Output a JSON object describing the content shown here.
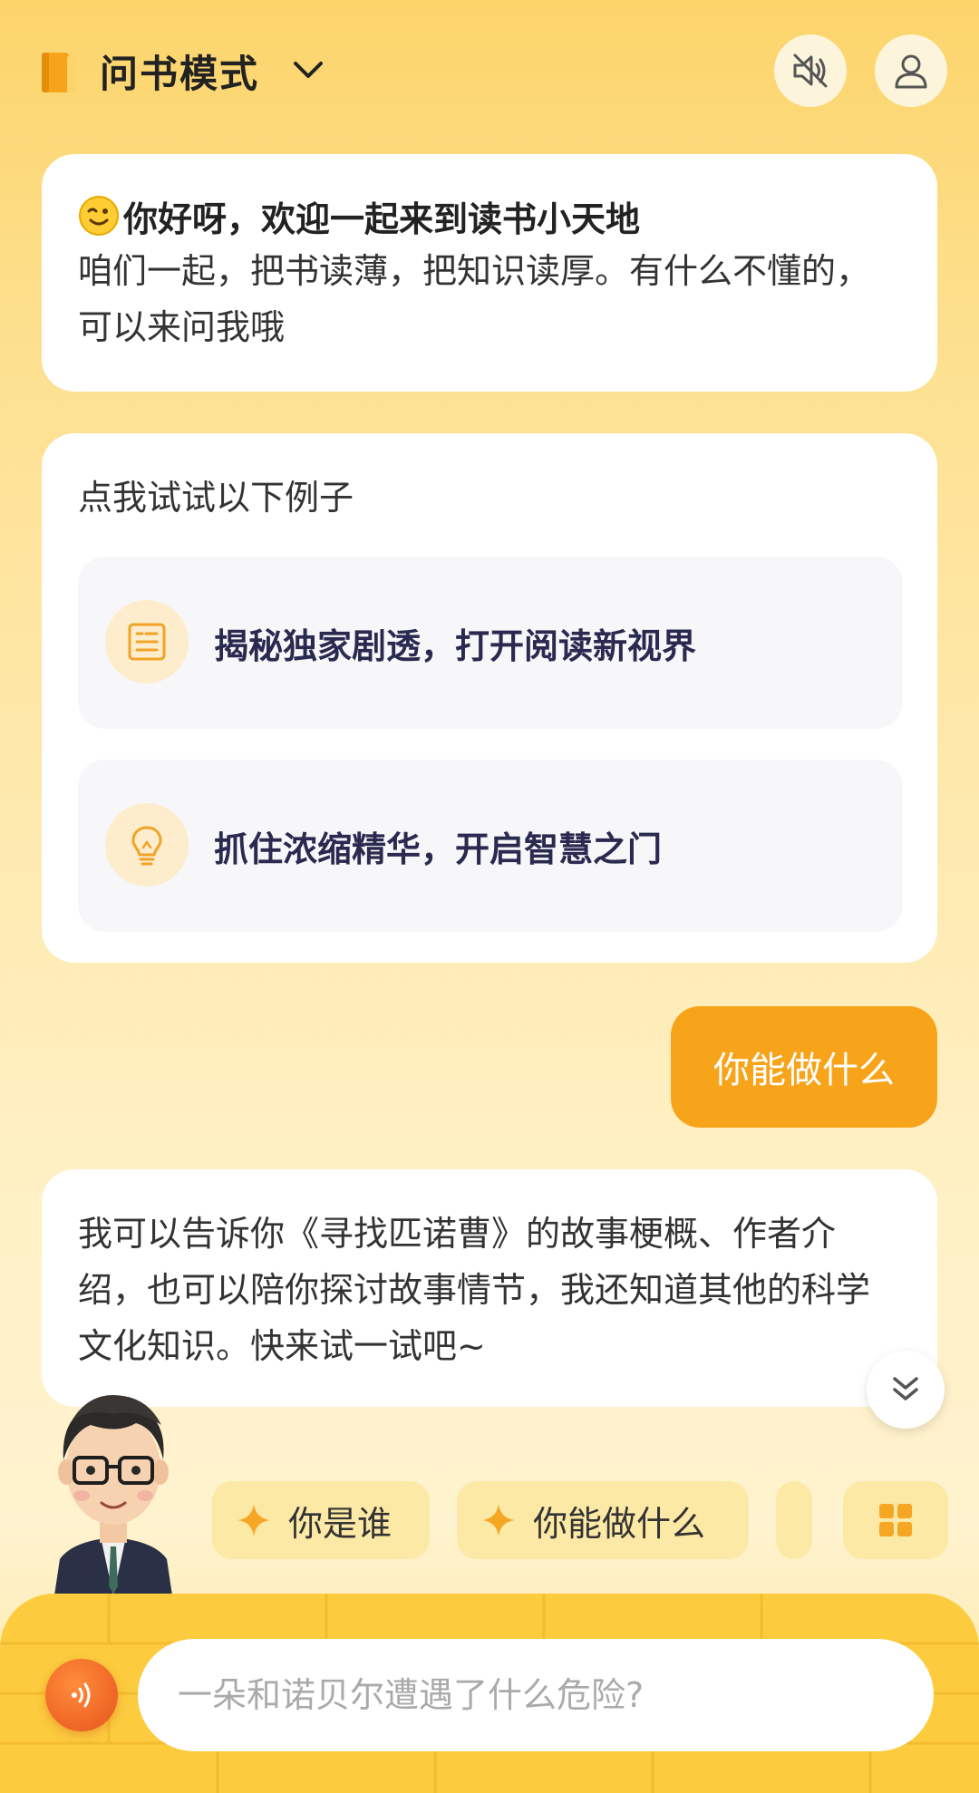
{
  "header": {
    "mode_title": "问书模式",
    "icons": {
      "book": "book-icon",
      "chevron": "chevron-down-icon",
      "mute": "speaker-mute-icon",
      "user": "user-icon"
    }
  },
  "welcome": {
    "title": "你好呀，欢迎一起来到读书小天地",
    "body": "咱们一起，把书读薄，把知识读厚。有什么不懂的，可以来问我哦"
  },
  "examples": {
    "title": "点我试试以下例子",
    "items": [
      {
        "label": "揭秘独家剧透，打开阅读新视界",
        "icon": "document-icon"
      },
      {
        "label": "抓住浓缩精华，开启智慧之门",
        "icon": "lightbulb-icon"
      }
    ]
  },
  "user_message": "你能做什么",
  "answer": "我可以告诉你《寻找匹诺曹》的故事梗概、作者介绍，也可以陪你探讨故事情节，我还知道其他的科学文化知识。快来试一试吧~",
  "chips": [
    {
      "label": "你是谁"
    },
    {
      "label": "你能做什么"
    }
  ],
  "input": {
    "placeholder": "一朵和诺贝尔遭遇了什么危险?"
  },
  "colors": {
    "accent": "#f7a41a",
    "background": "#fde08e",
    "example_text": "#2a2a50",
    "voice": "#e8541c"
  }
}
